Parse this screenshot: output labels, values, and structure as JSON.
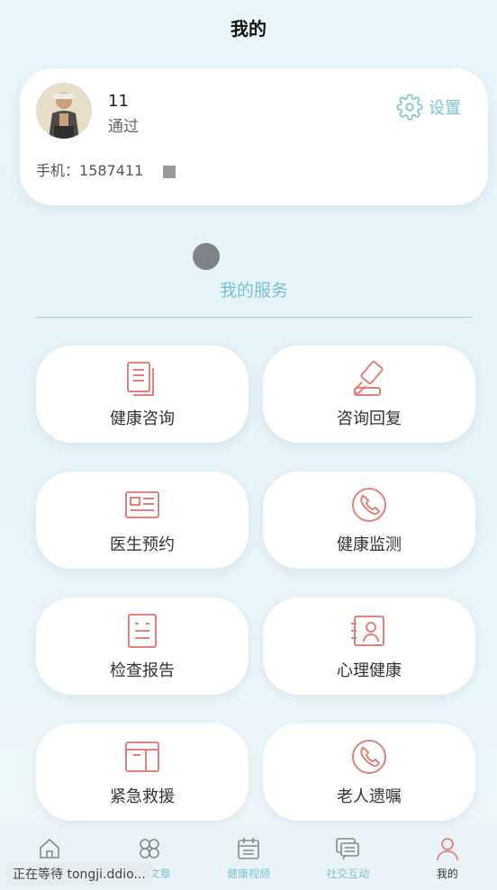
{
  "header": {
    "title": "我的"
  },
  "profile": {
    "name": "11",
    "status": "通过",
    "phone_label": "手机：",
    "phone_value": "1587411",
    "settings_label": "设置"
  },
  "services": {
    "title": "我的服务",
    "items": [
      {
        "label": "健康咨询",
        "icon": "document-icon"
      },
      {
        "label": "咨询回复",
        "icon": "hammer-icon"
      },
      {
        "label": "医生预约",
        "icon": "id-card-icon"
      },
      {
        "label": "健康监测",
        "icon": "phone-icon"
      },
      {
        "label": "检查报告",
        "icon": "report-icon"
      },
      {
        "label": "心理健康",
        "icon": "mind-icon"
      },
      {
        "label": "紧急救援",
        "icon": "box-icon"
      },
      {
        "label": "老人遗嘱",
        "icon": "phone-icon"
      }
    ]
  },
  "tabbar": {
    "items": [
      {
        "label": "首页",
        "icon": "home-icon"
      },
      {
        "label": "健康文章",
        "icon": "grid-icon"
      },
      {
        "label": "健康视频",
        "icon": "calendar-icon"
      },
      {
        "label": "社交互动",
        "icon": "chat-icon"
      },
      {
        "label": "我的",
        "icon": "user-icon"
      }
    ]
  },
  "status_overlay": {
    "text": "正在等待 tongji.ddio..."
  },
  "colors": {
    "accent": "#7cbfd6",
    "icon_red": "#e0807a"
  }
}
